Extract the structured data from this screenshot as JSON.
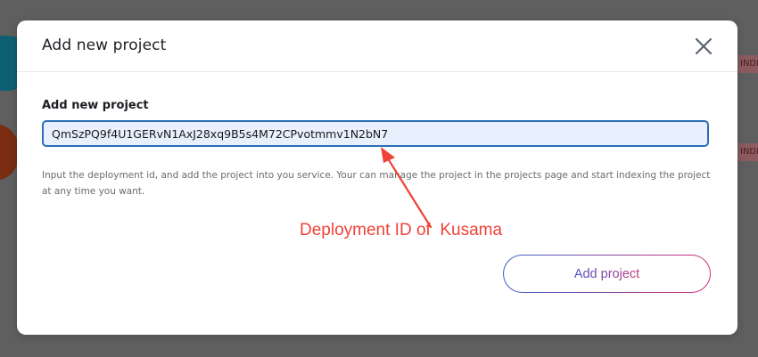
{
  "modal": {
    "title": "Add new project",
    "close_icon": "close-icon",
    "field_label": "Add new project",
    "deployment_input_value": "QmSzPQ9f4U1GERvN1AxJ28xq9B5s4M72CPvotmmv1N2bN7",
    "help_text": "Input the deployment id, and add the project into you service. Your can manage the project in the projects page and start indexing the project at any time you want.",
    "submit_label": "Add project"
  },
  "annotation": {
    "text": "Deployment ID of  Kusama",
    "color": "#ef4338"
  },
  "background": {
    "tag_1": "INDE",
    "tag_2": "INDE"
  },
  "colors": {
    "input_border": "#2c6db3",
    "input_bg": "#e8f0fe",
    "button_gradient_start": "#3b62c6",
    "button_gradient_end": "#d12c7c",
    "overlay": "#5f5f5f"
  }
}
